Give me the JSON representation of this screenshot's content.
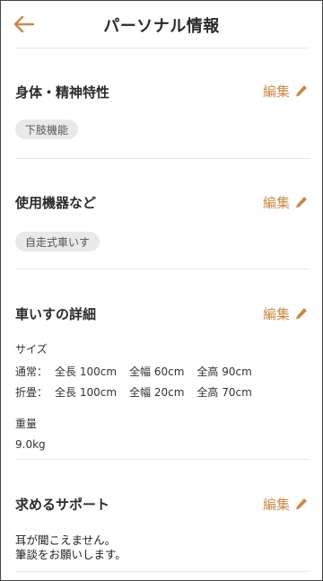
{
  "header": {
    "title": "パーソナル情報"
  },
  "sections": {
    "physical": {
      "title": "身体・精神特性",
      "edit_label": "編集",
      "chip": "下肢機能"
    },
    "equipment": {
      "title": "使用機器など",
      "edit_label": "編集",
      "chip": "自走式車いす"
    },
    "wheelchair": {
      "title": "車いすの詳細",
      "edit_label": "編集",
      "size_label": "サイズ",
      "normal": {
        "label": "通常：",
        "length": "全長 100cm",
        "width": "全幅 60cm",
        "height": "全高 90cm"
      },
      "folded": {
        "label": "折畳：",
        "length": "全長 100cm",
        "width": "全幅 20cm",
        "height": "全高 70cm"
      },
      "weight_label": "重量",
      "weight_value": "9.0kg"
    },
    "support": {
      "title": "求めるサポート",
      "edit_label": "編集",
      "line1": "耳が聞こえません。",
      "line2": "筆談をお願いします。"
    }
  },
  "colors": {
    "accent": "#c98a4a",
    "chip_bg": "#e9e9e9"
  }
}
